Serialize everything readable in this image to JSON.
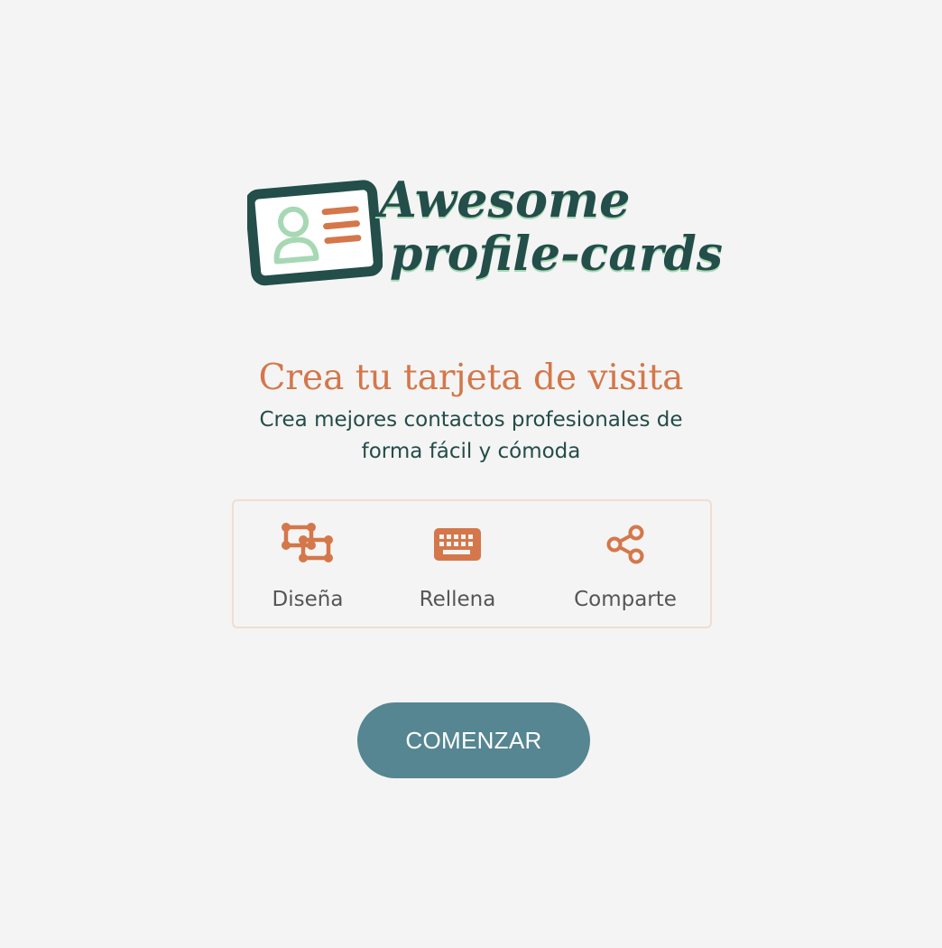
{
  "logo": {
    "line1": "Awesome",
    "line2": "profile-cards"
  },
  "hero": {
    "title": "Crea tu tarjeta de visita",
    "subtitle": "Crea mejores contactos profesionales de forma fácil y cómoda"
  },
  "features": [
    {
      "icon": "design-shapes-icon",
      "label": "Diseña"
    },
    {
      "icon": "keyboard-icon",
      "label": "Rellena"
    },
    {
      "icon": "share-icon",
      "label": "Comparte"
    }
  ],
  "cta": {
    "label": "COMENZAR"
  },
  "colors": {
    "background": "#f4f4f4",
    "accent_orange": "#d4774a",
    "dark_green": "#234e4a",
    "light_green": "#a6d8b4",
    "button": "#558691",
    "border": "#f1ddd1"
  }
}
